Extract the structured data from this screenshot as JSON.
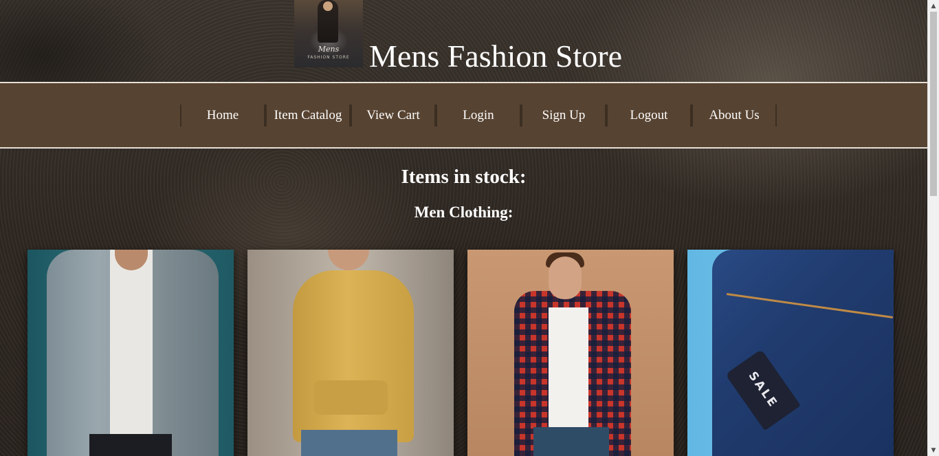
{
  "header": {
    "site_title": "Mens Fashion Store",
    "logo": {
      "text": "Mens",
      "subtext": "FASHION STORE"
    }
  },
  "nav": {
    "items": [
      {
        "label": "Home"
      },
      {
        "label": "Item Catalog"
      },
      {
        "label": "View Cart"
      },
      {
        "label": "Login"
      },
      {
        "label": "Sign Up"
      },
      {
        "label": "Logout"
      },
      {
        "label": "About Us"
      }
    ]
  },
  "main": {
    "heading": "Items in stock:",
    "category": "Men Clothing:",
    "products": [
      {
        "image": "denim-jacket"
      },
      {
        "image": "yellow-hoodie"
      },
      {
        "image": "plaid-shirt"
      },
      {
        "image": "jeans-sale-tag",
        "tag_text": "SALE"
      }
    ]
  },
  "colors": {
    "nav_background": "#574331",
    "nav_border": "#e6e0d8",
    "text": "#ffffff",
    "page_background": "#2f2822"
  },
  "scrollbar": {
    "up_icon": "chevron-up-icon",
    "down_icon": "chevron-down-icon"
  }
}
